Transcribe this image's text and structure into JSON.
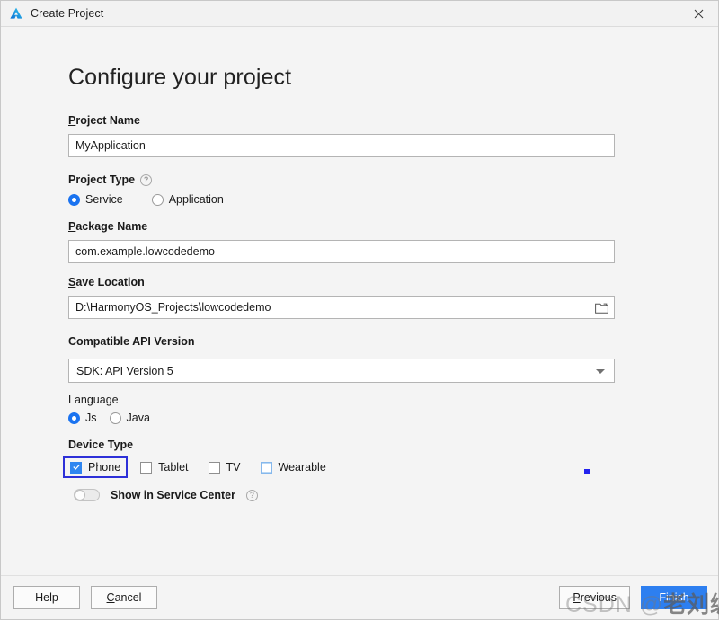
{
  "window": {
    "title": "Create Project",
    "logo_icon": "deveco-logo-icon",
    "close_icon": "close-icon"
  },
  "page": {
    "heading": "Configure your project"
  },
  "fields": {
    "project_name": {
      "label_mnemonic": "P",
      "label_rest": "roject Name",
      "value": "MyApplication"
    },
    "project_type": {
      "label_mnemonic": "",
      "label": "Project Type",
      "help_icon": "help-icon",
      "options": [
        {
          "label": "Service",
          "selected": true
        },
        {
          "label": "Application",
          "selected": false
        }
      ]
    },
    "package_name": {
      "label_mnemonic": "P",
      "label_rest": "ackage Name",
      "value": "com.example.lowcodedemo"
    },
    "save_location": {
      "label_mnemonic": "S",
      "label_rest": "ave Location",
      "value": "D:\\HarmonyOS_Projects\\lowcodedemo",
      "browse_icon": "folder-icon"
    },
    "api_version": {
      "label": "Compatible API Version",
      "value": "SDK: API Version 5",
      "dropdown_icon": "chevron-down-icon"
    },
    "language": {
      "label": "Language",
      "options": [
        {
          "label": "Js",
          "selected": true
        },
        {
          "label": "Java",
          "selected": false
        }
      ]
    },
    "device_type": {
      "label": "Device Type",
      "options": [
        {
          "label": "Phone",
          "checked": true,
          "focused": true
        },
        {
          "label": "Tablet",
          "checked": false,
          "focused": false
        },
        {
          "label": "TV",
          "checked": false,
          "focused": false
        },
        {
          "label": "Wearable",
          "checked": false,
          "focused": false,
          "hover": true
        }
      ]
    },
    "service_center": {
      "label": "Show in Service Center",
      "enabled": false,
      "help_icon": "help-icon"
    }
  },
  "footer": {
    "help_label": "Help",
    "cancel_mnemonic": "C",
    "cancel_rest": "ancel",
    "previous_mnemonic": "P",
    "previous_rest": "revious",
    "finish_label": "Finish"
  },
  "watermark": {
    "prefix": "CSDN @",
    "handle": "老刘编程"
  },
  "colors": {
    "accent_blue": "#2f86f0",
    "focus_border": "#2d30d8",
    "primary_button": "#2d7ff0",
    "marker_dot": "#2222ee"
  }
}
